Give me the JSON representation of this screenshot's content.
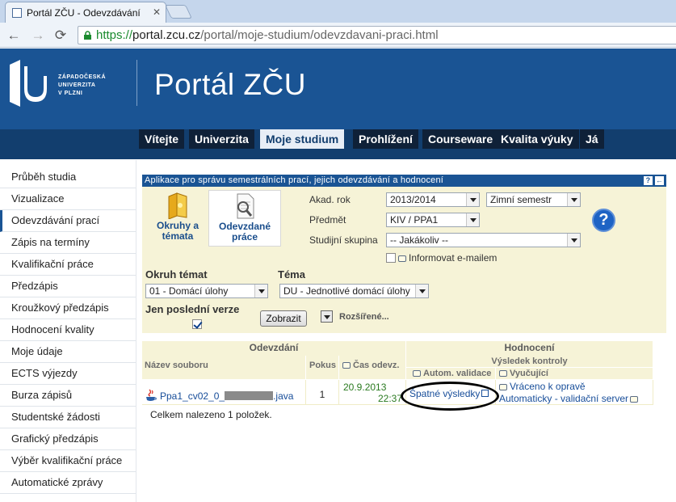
{
  "browser": {
    "tab_title": "Portál ZČU - Odevzdávání",
    "url_scheme": "https://",
    "url_host": "portal.zcu.cz",
    "url_path": "/portal/moje-studium/odevzdavani-praci.html"
  },
  "header": {
    "logo_lines": [
      "ZÁPADOČESKÁ",
      "UNIVERZITA",
      "V PLZNI"
    ],
    "title": "Portál ZČU"
  },
  "topnav": [
    {
      "label": "Vítejte",
      "active": false
    },
    {
      "label": "Univerzita",
      "active": false
    },
    {
      "label": "Moje studium",
      "active": true
    },
    {
      "label": "Prohlížení",
      "active": false
    },
    {
      "label": "Courseware",
      "active": false
    },
    {
      "label": "Kvalita výuky",
      "active": false
    },
    {
      "label": "Já",
      "active": false
    }
  ],
  "sidebar": [
    {
      "label": "Průběh studia",
      "active": false
    },
    {
      "label": "Vizualizace",
      "active": false
    },
    {
      "label": "Odevzdávání prací",
      "active": true
    },
    {
      "label": "Zápis na termíny",
      "active": false
    },
    {
      "label": "Kvalifikační práce",
      "active": false
    },
    {
      "label": "Předzápis",
      "active": false
    },
    {
      "label": "Kroužkový předzápis",
      "active": false
    },
    {
      "label": "Hodnocení kvality",
      "active": false
    },
    {
      "label": "Moje údaje",
      "active": false
    },
    {
      "label": "ECTS výjezdy",
      "active": false
    },
    {
      "label": "Burza zápisů",
      "active": false
    },
    {
      "label": "Studentské žádosti",
      "active": false
    },
    {
      "label": "Grafický předzápis",
      "active": false
    },
    {
      "label": "Výběr kvalifikační práce",
      "active": false
    },
    {
      "label": "Automatické zprávy",
      "active": false
    }
  ],
  "app": {
    "title": "Aplikace pro správu semestrálních prací, jejich odevzdávání a hodnocení",
    "help_label": "?",
    "back_label": "←",
    "tab_okruhy": [
      "Okruhy a",
      "témata"
    ],
    "tab_odevzdane": [
      "Odevzdané",
      "práce"
    ],
    "akad_rok_label": "Akad. rok",
    "akad_rok_value": "2013/2014",
    "semestr_value": "Zimní semestr",
    "predmet_label": "Předmět",
    "predmet_value": "KIV / PPA1",
    "skupina_label": "Studijní skupina",
    "skupina_value": "-- Jakákoliv --",
    "informovat_label": "Informovat e-mailem",
    "help_big": "?",
    "okruh_label": "Okruh témat",
    "okruh_value": "01 - Domácí úlohy",
    "tema_label": "Téma",
    "tema_value": "DU - Jednotlivé domácí úlohy",
    "posledni_label": "Jen poslední verze",
    "posledni_checked": true,
    "zobrazit_label": "Zobrazit",
    "rozsirene_label": "Rozšířené..."
  },
  "results": {
    "group_odevzdani": "Odevzdání",
    "group_hodnoceni": "Hodnocení",
    "sub_vysledek": "Výsledek kontroly",
    "col_nazev": "Název souboru",
    "col_pokus": "Pokus",
    "col_cas": "Čas odevz.",
    "col_autom": "Autom. validace",
    "col_vyucujici": "Vyučující",
    "rows": [
      {
        "file_prefix": "Ppa1_cv02_0_",
        "file_suffix": ".java",
        "pokus": "1",
        "date": "20.9.2013",
        "time": "22:37",
        "autom": "Špatné výsledky",
        "vyucujici_1": "Vráceno k opravě",
        "vyucujici_2": "Automaticky - validační server"
      }
    ],
    "summary": "Celkem nalezeno 1 položek."
  },
  "colors": {
    "header_blue": "#1a5494",
    "nav_dark": "#0f2138",
    "app_bg": "#f6f3d7",
    "link": "#174d99",
    "url_green": "#1a8a2e"
  }
}
